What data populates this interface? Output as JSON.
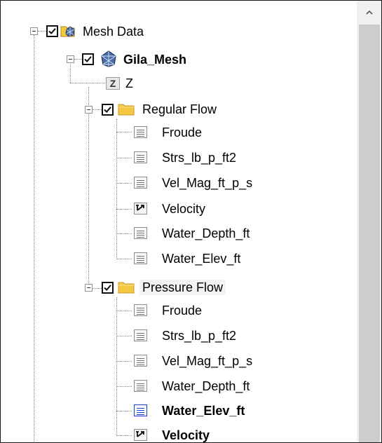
{
  "tree": {
    "root": {
      "label": "Mesh Data",
      "checked": true,
      "expanded": true
    },
    "mesh": {
      "label": "Gila_Mesh",
      "checked": true,
      "expanded": true
    },
    "z_dataset": {
      "label": "Z"
    },
    "regular_flow": {
      "label": "Regular Flow",
      "checked": true,
      "expanded": true,
      "items": [
        {
          "label": "Froude",
          "icon": "scalar-dataset-icon"
        },
        {
          "label": "Strs_lb_p_ft2",
          "icon": "scalar-dataset-icon"
        },
        {
          "label": "Vel_Mag_ft_p_s",
          "icon": "scalar-dataset-icon"
        },
        {
          "label": "Velocity",
          "icon": "vector-dataset-icon"
        },
        {
          "label": "Water_Depth_ft",
          "icon": "scalar-dataset-icon"
        },
        {
          "label": "Water_Elev_ft",
          "icon": "scalar-dataset-icon"
        }
      ]
    },
    "pressure_flow": {
      "label": "Pressure Flow",
      "checked": true,
      "expanded": true,
      "items": [
        {
          "label": "Froude",
          "icon": "scalar-dataset-icon"
        },
        {
          "label": "Strs_lb_p_ft2",
          "icon": "scalar-dataset-icon"
        },
        {
          "label": "Vel_Mag_ft_p_s",
          "icon": "scalar-dataset-icon"
        },
        {
          "label": "Water_Depth_ft",
          "icon": "scalar-dataset-icon"
        },
        {
          "label": "Water_Elev_ft",
          "icon": "scalar-dataset-icon",
          "active": true
        },
        {
          "label": "Velocity",
          "icon": "vector-dataset-icon",
          "active": true
        }
      ]
    }
  },
  "colors": {
    "active_scalar_icon": "#1a3fd0",
    "folder": "#f5c842",
    "selection_bg": "#f3f3f3",
    "scrollbar_track": "#f0f0f0",
    "scrollbar_thumb": "#cdcdcd"
  }
}
